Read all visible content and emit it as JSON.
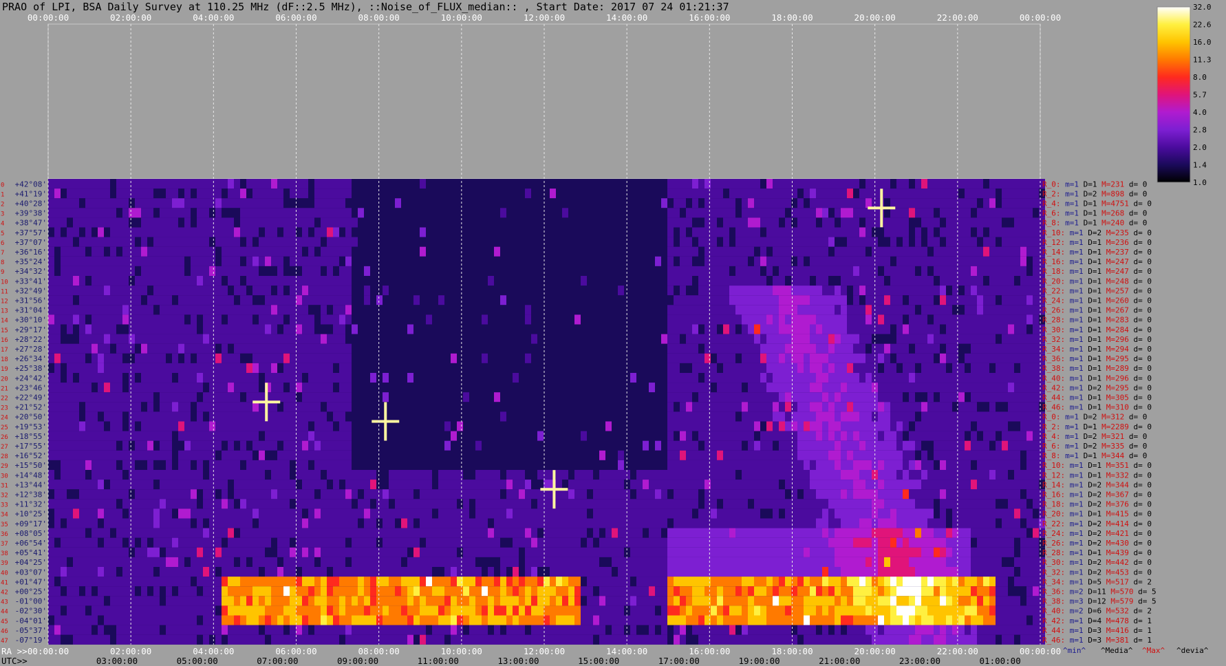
{
  "title": "PRAO of LPI, BSA Daily Survey at 110.25 MHz (dF::2.5 MHz), ::Noise_of_FLUX_median:: , Start Date: 2017 07 24 01:21:37",
  "chart_data": {
    "type": "heatmap",
    "title": "PRAO of LPI, BSA Daily Survey at 110.25 MHz (dF::2.5 MHz), ::Noise_of_FLUX_median:: , Start Date: 2017 07 24 01:21:37",
    "ra_ticks_top": [
      "00:00:00",
      "02:00:00",
      "04:00:00",
      "06:00:00",
      "08:00:00",
      "10:00:00",
      "12:00:00",
      "14:00:00",
      "16:00:00",
      "18:00:00",
      "20:00:00",
      "22:00:00",
      "00:00:00"
    ],
    "ra_ticks_bottom": [
      "00:00:00",
      "02:00:00",
      "04:00:00",
      "06:00:00",
      "08:00:00",
      "10:00:00",
      "12:00:00",
      "14:00:00",
      "16:00:00",
      "18:00:00",
      "20:00:00",
      "22:00:00",
      "00:00:00"
    ],
    "ra_label": "RA >>",
    "utc_label": "UTC>>",
    "utc_ticks": [
      "03:00:00",
      "05:00:00",
      "07:00:00",
      "09:00:00",
      "11:00:00",
      "13:00:00",
      "15:00:00",
      "17:00:00",
      "19:00:00",
      "21:00:00",
      "23:00:00",
      "01:00:00"
    ],
    "colorbar_ticks": [
      "32.0",
      "22.6",
      "16.0",
      "11.3",
      "8.0",
      "5.7",
      "4.0",
      "2.8",
      "2.0",
      "1.4",
      "1.0"
    ],
    "colorbar_colors": [
      "#000000",
      "#1a0a5a",
      "#4b0b9e",
      "#7d1fd2",
      "#b01bd0",
      "#e0147a",
      "#ff2a1e",
      "#ff7a00",
      "#ffc400",
      "#fff040",
      "#ffffff"
    ],
    "dec_labels": [
      "+42°08'",
      "+41°19'",
      "+40°28'",
      "+39°38'",
      "+38°47'",
      "+37°57'",
      "+37°07'",
      "+36°16'",
      "+35°24'",
      "+34°32'",
      "+33°41'",
      "+32°49'",
      "+31°56'",
      "+31°04'",
      "+30°10'",
      "+29°17'",
      "+28°22'",
      "+27°28'",
      "+26°34'",
      "+25°38'",
      "+24°42'",
      "+23°46'",
      "+22°49'",
      "+21°52'",
      "+20°50'",
      "+19°53'",
      "+18°55'",
      "+17°55'",
      "+16°52'",
      "+15°50'",
      "+14°48'",
      "+13°44'",
      "+12°38'",
      "+11°32'",
      "+10°25'",
      "+09°17'",
      "+08°05'",
      "+06°54'",
      "+05°41'",
      "+04°25'",
      "+03°07'",
      "+01°47'",
      "+00°25'",
      "-01°00'",
      "-02°30'",
      "-04°01'",
      "-05°37'",
      "-07°19'"
    ],
    "row_indices": [
      "0",
      "1",
      "2",
      "3",
      "4",
      "5",
      "6",
      "7",
      "8",
      "9",
      "10",
      "11",
      "12",
      "13",
      "14",
      "15",
      "16",
      "17",
      "18",
      "19",
      "20",
      "21",
      "22",
      "23",
      "24",
      "25",
      "26",
      "27",
      "28",
      "29",
      "30",
      "31",
      "32",
      "33",
      "34",
      "35",
      "36",
      "37",
      "38",
      "39",
      "40",
      "41",
      "42",
      "43",
      "44",
      "45",
      "46",
      "47"
    ],
    "stats_header": [
      "^min^",
      "^Media^",
      "^Max^",
      "^devia^"
    ],
    "stats": [
      {
        "r": "R_0:",
        "m": "m=1",
        "d": "D=1",
        "M": "M=231",
        "dv": "d= 0"
      },
      {
        "r": "R_2:",
        "m": "m=1",
        "d": "D=2",
        "M": "M=898",
        "dv": "d= 0"
      },
      {
        "r": "R_4:",
        "m": "m=1",
        "d": "D=1",
        "M": "M=4751",
        "dv": "d= 0"
      },
      {
        "r": "R_6:",
        "m": "m=1",
        "d": "D=1",
        "M": "M=268",
        "dv": "d= 0"
      },
      {
        "r": "R_8:",
        "m": "m=1",
        "d": "D=1",
        "M": "M=240",
        "dv": "d= 0"
      },
      {
        "r": "R_10:",
        "m": "m=1",
        "d": "D=2",
        "M": "M=235",
        "dv": "d= 0"
      },
      {
        "r": "R_12:",
        "m": "m=1",
        "d": "D=1",
        "M": "M=236",
        "dv": "d= 0"
      },
      {
        "r": "R_14:",
        "m": "m=1",
        "d": "D=1",
        "M": "M=237",
        "dv": "d= 0"
      },
      {
        "r": "R_16:",
        "m": "m=1",
        "d": "D=1",
        "M": "M=247",
        "dv": "d= 0"
      },
      {
        "r": "R_18:",
        "m": "m=1",
        "d": "D=1",
        "M": "M=247",
        "dv": "d= 0"
      },
      {
        "r": "R_20:",
        "m": "m=1",
        "d": "D=1",
        "M": "M=248",
        "dv": "d= 0"
      },
      {
        "r": "R_22:",
        "m": "m=1",
        "d": "D=1",
        "M": "M=257",
        "dv": "d= 0"
      },
      {
        "r": "R_24:",
        "m": "m=1",
        "d": "D=1",
        "M": "M=260",
        "dv": "d= 0"
      },
      {
        "r": "R_26:",
        "m": "m=1",
        "d": "D=1",
        "M": "M=267",
        "dv": "d= 0"
      },
      {
        "r": "R_28:",
        "m": "m=1",
        "d": "D=1",
        "M": "M=283",
        "dv": "d= 0"
      },
      {
        "r": "R_30:",
        "m": "m=1",
        "d": "D=1",
        "M": "M=284",
        "dv": "d= 0"
      },
      {
        "r": "R_32:",
        "m": "m=1",
        "d": "D=1",
        "M": "M=296",
        "dv": "d= 0"
      },
      {
        "r": "R_34:",
        "m": "m=1",
        "d": "D=1",
        "M": "M=294",
        "dv": "d= 0"
      },
      {
        "r": "R_36:",
        "m": "m=1",
        "d": "D=1",
        "M": "M=295",
        "dv": "d= 0"
      },
      {
        "r": "R_38:",
        "m": "m=1",
        "d": "D=1",
        "M": "M=289",
        "dv": "d= 0"
      },
      {
        "r": "R_40:",
        "m": "m=1",
        "d": "D=1",
        "M": "M=296",
        "dv": "d= 0"
      },
      {
        "r": "R_42:",
        "m": "m=1",
        "d": "D=2",
        "M": "M=295",
        "dv": "d= 0"
      },
      {
        "r": "R_44:",
        "m": "m=1",
        "d": "D=1",
        "M": "M=305",
        "dv": "d= 0"
      },
      {
        "r": "R_46:",
        "m": "m=1",
        "d": "D=1",
        "M": "M=310",
        "dv": "d= 0"
      },
      {
        "r": "R_0:",
        "m": "m=1",
        "d": "D=2",
        "M": "M=312",
        "dv": "d= 0"
      },
      {
        "r": "R_2:",
        "m": "m=1",
        "d": "D=1",
        "M": "M=2289",
        "dv": "d= 0"
      },
      {
        "r": "R_4:",
        "m": "m=1",
        "d": "D=2",
        "M": "M=321",
        "dv": "d= 0"
      },
      {
        "r": "R_6:",
        "m": "m=1",
        "d": "D=2",
        "M": "M=335",
        "dv": "d= 0"
      },
      {
        "r": "R_8:",
        "m": "m=1",
        "d": "D=1",
        "M": "M=344",
        "dv": "d= 0"
      },
      {
        "r": "R_10:",
        "m": "m=1",
        "d": "D=1",
        "M": "M=351",
        "dv": "d= 0"
      },
      {
        "r": "R_12:",
        "m": "m=1",
        "d": "D=1",
        "M": "M=332",
        "dv": "d= 0"
      },
      {
        "r": "R_14:",
        "m": "m=1",
        "d": "D=2",
        "M": "M=344",
        "dv": "d= 0"
      },
      {
        "r": "R_16:",
        "m": "m=1",
        "d": "D=2",
        "M": "M=367",
        "dv": "d= 0"
      },
      {
        "r": "R_18:",
        "m": "m=1",
        "d": "D=2",
        "M": "M=376",
        "dv": "d= 0"
      },
      {
        "r": "R_20:",
        "m": "m=1",
        "d": "D=1",
        "M": "M=415",
        "dv": "d= 0"
      },
      {
        "r": "R_22:",
        "m": "m=1",
        "d": "D=2",
        "M": "M=414",
        "dv": "d= 0"
      },
      {
        "r": "R_24:",
        "m": "m=1",
        "d": "D=2",
        "M": "M=421",
        "dv": "d= 0"
      },
      {
        "r": "R_26:",
        "m": "m=1",
        "d": "D=2",
        "M": "M=430",
        "dv": "d= 0"
      },
      {
        "r": "R_28:",
        "m": "m=1",
        "d": "D=1",
        "M": "M=439",
        "dv": "d= 0"
      },
      {
        "r": "R_30:",
        "m": "m=1",
        "d": "D=2",
        "M": "M=442",
        "dv": "d= 0"
      },
      {
        "r": "R_32:",
        "m": "m=1",
        "d": "D=2",
        "M": "M=453",
        "dv": "d= 0"
      },
      {
        "r": "R_34:",
        "m": "m=1",
        "d": "D=5",
        "M": "M=517",
        "dv": "d= 2"
      },
      {
        "r": "R_36:",
        "m": "m=2",
        "d": "D=11",
        "M": "M=570",
        "dv": "d= 5"
      },
      {
        "r": "R_38:",
        "m": "m=3",
        "d": "D=12",
        "M": "M=579",
        "dv": "d= 5"
      },
      {
        "r": "R_40:",
        "m": "m=2",
        "d": "D=6",
        "M": "M=532",
        "dv": "d= 2"
      },
      {
        "r": "R_42:",
        "m": "m=1",
        "d": "D=4",
        "M": "M=478",
        "dv": "d= 1"
      },
      {
        "r": "R_44:",
        "m": "m=1",
        "d": "D=3",
        "M": "M=416",
        "dv": "d= 1"
      },
      {
        "r": "R_46:",
        "m": "m=1",
        "d": "D=3",
        "M": "M=381",
        "dv": "d= 1"
      }
    ]
  }
}
